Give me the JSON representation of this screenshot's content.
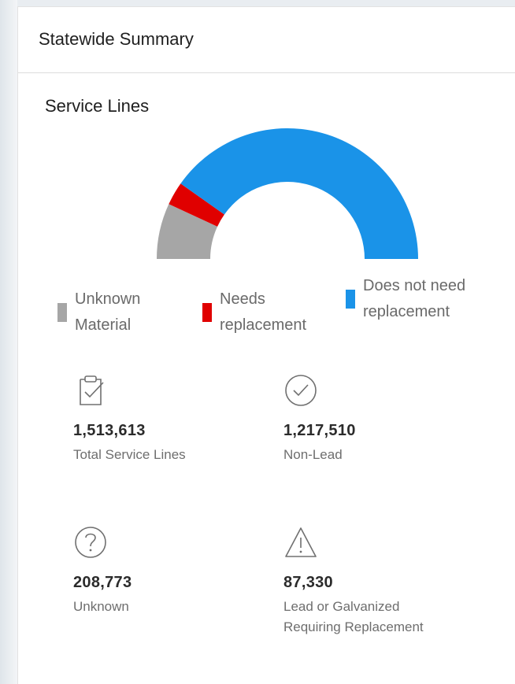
{
  "panel": {
    "title": "Statewide Summary"
  },
  "section": {
    "title": "Service Lines"
  },
  "chart_data": {
    "type": "pie",
    "style": "half-donut gauge",
    "title": "Service Lines",
    "series": [
      {
        "name": "Unknown Material",
        "value": 208773,
        "color": "#a6a6a6"
      },
      {
        "name": "Needs replacement",
        "value": 87330,
        "color": "#e00000"
      },
      {
        "name": "Does not need replacement",
        "value": 1217510,
        "color": "#1a93e8"
      }
    ],
    "legend_placement": "bottom"
  },
  "legend": [
    {
      "label": "Unknown Material",
      "color": "#a6a6a6"
    },
    {
      "label": "Needs replacement",
      "color": "#e00000"
    },
    {
      "label": "Does not need replacement",
      "color": "#1a93e8"
    }
  ],
  "stats": [
    {
      "icon": "clipboard-check-icon",
      "value": "1,513,613",
      "label": "Total Service Lines"
    },
    {
      "icon": "check-circle-icon",
      "value": "1,217,510",
      "label": "Non-Lead"
    },
    {
      "icon": "question-circle-icon",
      "value": "208,773",
      "label": "Unknown"
    },
    {
      "icon": "warning-triangle-icon",
      "value": "87,330",
      "label": "Lead or Galvanized Requiring Replacement"
    }
  ]
}
